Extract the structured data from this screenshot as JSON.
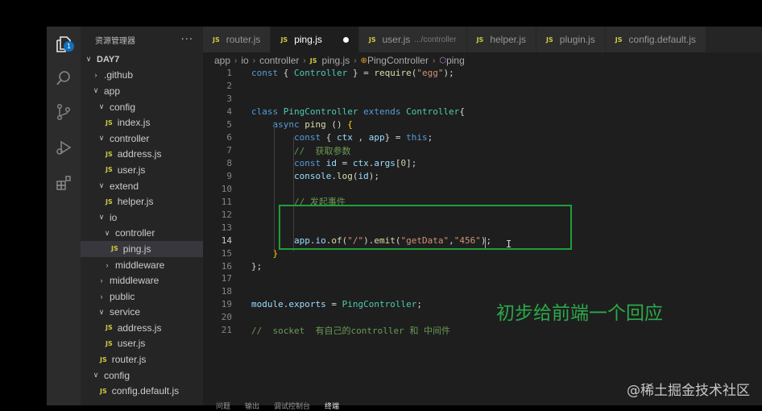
{
  "colors": {
    "accent": "#0e70c0",
    "annotation_green": "#1f9e3a",
    "js_badge": "#cbcb41"
  },
  "activity_bar": {
    "icons": [
      "files-icon",
      "search-icon",
      "source-control-icon",
      "run-debug-icon",
      "extensions-icon"
    ],
    "explorer_badge": "1"
  },
  "sidebar": {
    "title": "资源管理器",
    "more": "···",
    "tree": [
      {
        "label": "DAY7",
        "type": "root",
        "expanded": true,
        "depth": 0
      },
      {
        "label": ".github",
        "type": "folder",
        "expanded": false,
        "depth": 1
      },
      {
        "label": "app",
        "type": "folder",
        "expanded": true,
        "depth": 1
      },
      {
        "label": "config",
        "type": "folder",
        "expanded": true,
        "depth": 2
      },
      {
        "label": "index.js",
        "type": "file",
        "depth": 3
      },
      {
        "label": "controller",
        "type": "folder",
        "expanded": true,
        "depth": 2
      },
      {
        "label": "address.js",
        "type": "file",
        "depth": 3
      },
      {
        "label": "user.js",
        "type": "file",
        "depth": 3
      },
      {
        "label": "extend",
        "type": "folder",
        "expanded": true,
        "depth": 2
      },
      {
        "label": "helper.js",
        "type": "file",
        "depth": 3
      },
      {
        "label": "io",
        "type": "folder",
        "expanded": true,
        "depth": 2
      },
      {
        "label": "controller",
        "type": "folder",
        "expanded": true,
        "depth": 3
      },
      {
        "label": "ping.js",
        "type": "file",
        "depth": 4,
        "selected": true
      },
      {
        "label": "middleware",
        "type": "folder",
        "expanded": false,
        "depth": 3
      },
      {
        "label": "middleware",
        "type": "folder",
        "expanded": false,
        "depth": 2
      },
      {
        "label": "public",
        "type": "folder",
        "expanded": false,
        "depth": 2
      },
      {
        "label": "service",
        "type": "folder",
        "expanded": true,
        "depth": 2
      },
      {
        "label": "address.js",
        "type": "file",
        "depth": 3
      },
      {
        "label": "user.js",
        "type": "file",
        "depth": 3
      },
      {
        "label": "router.js",
        "type": "file",
        "depth": 2
      },
      {
        "label": "config",
        "type": "folder",
        "expanded": true,
        "depth": 1
      },
      {
        "label": "config.default.js",
        "type": "file",
        "depth": 2
      }
    ]
  },
  "tabs": [
    {
      "label": "router.js",
      "active": false
    },
    {
      "label": "ping.js",
      "active": true,
      "modified": true
    },
    {
      "label": "user.js",
      "desc": ".../controller",
      "active": false
    },
    {
      "label": "helper.js",
      "active": false
    },
    {
      "label": "plugin.js",
      "active": false
    },
    {
      "label": "config.default.js",
      "active": false
    }
  ],
  "js_badge": "JS",
  "breadcrumb": [
    "app",
    "io",
    "controller",
    "ping.js",
    "PingController",
    "ping"
  ],
  "code": [
    {
      "n": "1",
      "tokens": [
        [
          "kw",
          "const "
        ],
        [
          "punc",
          "{ "
        ],
        [
          "cls",
          "Controller"
        ],
        [
          "punc",
          " } = "
        ],
        [
          "fn",
          "require"
        ],
        [
          "punc",
          "("
        ],
        [
          "str",
          "\"egg\""
        ],
        [
          "punc",
          ");"
        ]
      ]
    },
    {
      "n": "2",
      "tokens": []
    },
    {
      "n": "3",
      "tokens": []
    },
    {
      "n": "4",
      "tokens": [
        [
          "kw",
          "class "
        ],
        [
          "cls",
          "PingController"
        ],
        [
          "kw",
          " extends "
        ],
        [
          "cls",
          "Controller"
        ],
        [
          "punc",
          "{"
        ]
      ]
    },
    {
      "n": "5",
      "tokens": [
        [
          "punc",
          "    "
        ],
        [
          "kw",
          "async "
        ],
        [
          "fn",
          "ping"
        ],
        [
          "punc",
          " () "
        ],
        [
          "brk",
          "{"
        ]
      ]
    },
    {
      "n": "6",
      "tokens": [
        [
          "punc",
          "        "
        ],
        [
          "kw",
          "const "
        ],
        [
          "punc",
          "{ "
        ],
        [
          "var",
          "ctx"
        ],
        [
          "punc",
          " , "
        ],
        [
          "var",
          "app"
        ],
        [
          "punc",
          "} = "
        ],
        [
          "kw",
          "this"
        ],
        [
          "punc",
          ";"
        ]
      ]
    },
    {
      "n": "7",
      "tokens": [
        [
          "punc",
          "        "
        ],
        [
          "cmt",
          "//  获取参数"
        ]
      ]
    },
    {
      "n": "8",
      "tokens": [
        [
          "punc",
          "        "
        ],
        [
          "kw",
          "const "
        ],
        [
          "var",
          "id"
        ],
        [
          "punc",
          " = "
        ],
        [
          "var",
          "ctx"
        ],
        [
          "punc",
          "."
        ],
        [
          "var",
          "args"
        ],
        [
          "punc",
          "["
        ],
        [
          "num",
          "0"
        ],
        [
          "punc",
          "];"
        ]
      ]
    },
    {
      "n": "9",
      "tokens": [
        [
          "punc",
          "        "
        ],
        [
          "var",
          "console"
        ],
        [
          "punc",
          "."
        ],
        [
          "fn",
          "log"
        ],
        [
          "punc",
          "("
        ],
        [
          "var",
          "id"
        ],
        [
          "punc",
          ");"
        ]
      ]
    },
    {
      "n": "10",
      "tokens": []
    },
    {
      "n": "11",
      "tokens": [
        [
          "punc",
          "        "
        ],
        [
          "cmt",
          "// 发起事件"
        ]
      ]
    },
    {
      "n": "12",
      "tokens": []
    },
    {
      "n": "13",
      "tokens": []
    },
    {
      "n": "14",
      "tokens": [
        [
          "punc",
          "        "
        ],
        [
          "var",
          "app"
        ],
        [
          "punc",
          "."
        ],
        [
          "var",
          "io"
        ],
        [
          "punc",
          "."
        ],
        [
          "fn",
          "of"
        ],
        [
          "punc",
          "("
        ],
        [
          "str",
          "\"/\""
        ],
        [
          "punc",
          ")."
        ],
        [
          "fn",
          "emit"
        ],
        [
          "punc",
          "("
        ],
        [
          "str",
          "\"getData\""
        ],
        [
          "punc",
          ","
        ],
        [
          "str",
          "\"456\""
        ],
        [
          "punc",
          ");"
        ]
      ],
      "current": true
    },
    {
      "n": "15",
      "tokens": [
        [
          "punc",
          "    "
        ],
        [
          "brk",
          "}"
        ]
      ]
    },
    {
      "n": "16",
      "tokens": [
        [
          "punc",
          "};"
        ]
      ]
    },
    {
      "n": "17",
      "tokens": []
    },
    {
      "n": "18",
      "tokens": []
    },
    {
      "n": "19",
      "tokens": [
        [
          "var",
          "module"
        ],
        [
          "punc",
          "."
        ],
        [
          "var",
          "exports"
        ],
        [
          "punc",
          " = "
        ],
        [
          "cls",
          "PingController"
        ],
        [
          "punc",
          ";"
        ]
      ]
    },
    {
      "n": "20",
      "tokens": []
    },
    {
      "n": "21",
      "tokens": [
        [
          "cmt",
          "//  socket  有自己的controller 和 中间件"
        ]
      ]
    }
  ],
  "annotation": "初步给前端一个回应",
  "watermark": "@稀土掘金技术社区",
  "panel_tabs": [
    "问题",
    "输出",
    "调试控制台",
    "终端"
  ]
}
